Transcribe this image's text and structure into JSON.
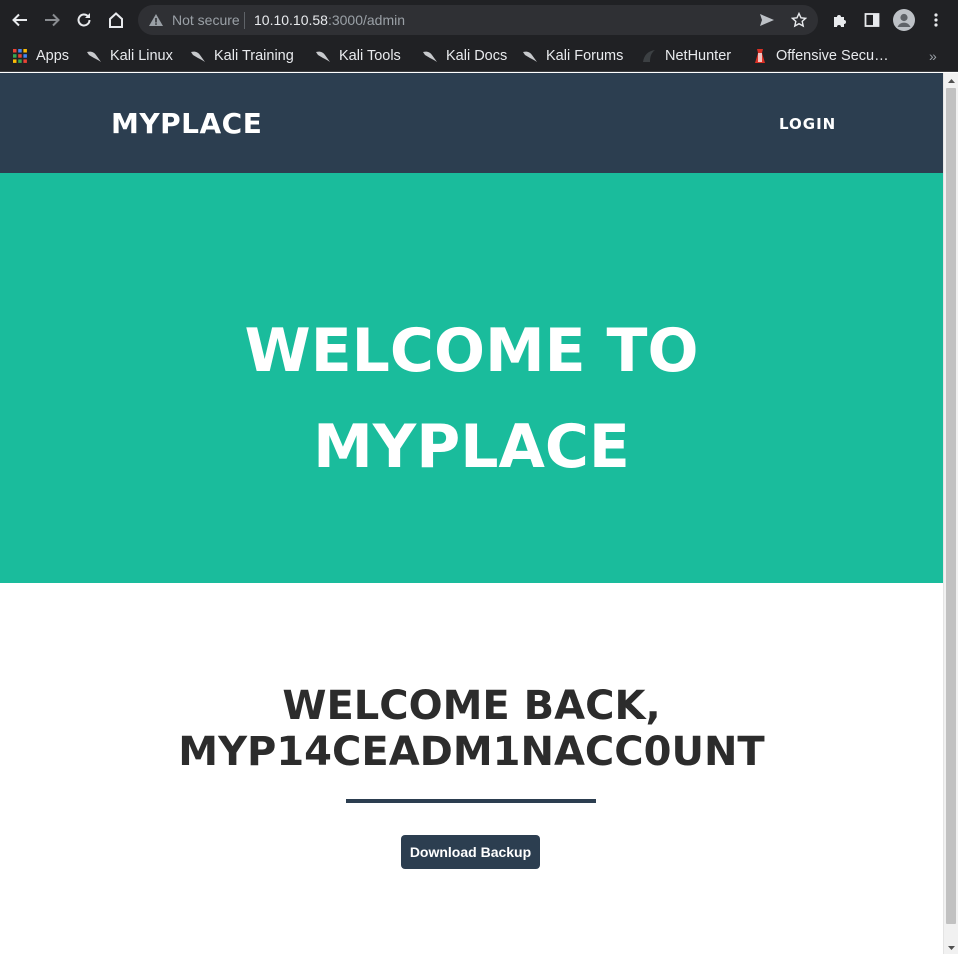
{
  "browser": {
    "omnibox": {
      "security_label": "Not secure",
      "url_host": "10.10.10.58",
      "url_rest": ":3000/admin"
    },
    "bookmarks": [
      {
        "label": "Apps",
        "icon": "apps-grid-icon"
      },
      {
        "label": "Kali Linux",
        "icon": "kali-dragon-icon"
      },
      {
        "label": "Kali Training",
        "icon": "kali-dragon-icon"
      },
      {
        "label": "Kali Tools",
        "icon": "kali-dragon-icon"
      },
      {
        "label": "Kali Docs",
        "icon": "kali-dragon-icon"
      },
      {
        "label": "Kali Forums",
        "icon": "kali-dragon-icon"
      },
      {
        "label": "NetHunter",
        "icon": "nethunter-icon"
      },
      {
        "label": "Offensive Secu…",
        "icon": "offsec-icon"
      }
    ],
    "colors": {
      "chrome_bg": "#202124",
      "omnibox_bg": "#2f3034"
    }
  },
  "site": {
    "brand": "MYPLACE",
    "nav_login": "LOGIN",
    "hero_line1": "WELCOME TO",
    "hero_line2": "MYPLACE",
    "welcome_line1": "WELCOME BACK,",
    "welcome_line2": "MYP14CEADM1NACC0UNT",
    "backup_button": "Download Backup",
    "colors": {
      "navbar": "#2c3e50",
      "hero": "#1abc9c",
      "button": "#2c3e50"
    }
  }
}
